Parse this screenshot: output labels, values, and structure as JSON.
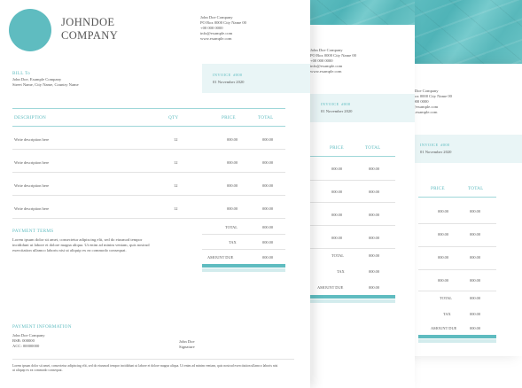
{
  "company": {
    "line1": "JOHNDOE",
    "line2": "COMPANY"
  },
  "contact": {
    "name": "John Doe Company",
    "address": "PO Box 0000 City Name 00",
    "phone": "+00 000 0000",
    "email": "info@example.com",
    "web": "www.example.com"
  },
  "bill_to": {
    "label": "BILL To",
    "name": "John Doe, Example Company",
    "street": "Street Name, City Name, Country Name"
  },
  "invoice": {
    "title": "INVOICE",
    "number": "#000",
    "date": "01 November 2020"
  },
  "table": {
    "headers": {
      "description": "DESCRIPTION",
      "qty": "QTY",
      "price": "PRICE",
      "total": "TOTAL"
    },
    "rows": [
      {
        "description": "Write description here",
        "qty": "12",
        "price": "000.00",
        "total": "000.00"
      },
      {
        "description": "Write description here",
        "qty": "12",
        "price": "000.00",
        "total": "000.00"
      },
      {
        "description": "Write description here",
        "qty": "12",
        "price": "000.00",
        "total": "000.00"
      },
      {
        "description": "Write description here",
        "qty": "12",
        "price": "000.00",
        "total": "000.00"
      }
    ]
  },
  "totals": {
    "total_label": "TOTAL",
    "total_value": "000.00",
    "tax_label": "TAX",
    "tax_value": "000.00",
    "due_label": "AMOUNT DUE",
    "due_value": "000.00"
  },
  "terms": {
    "label": "PAYMENT TERMS",
    "text": "Lorem ipsum dolor sit amet, consectetur adipiscing elit, sed do eiusmod tempor incididunt ut labore et dolore magna aliqua. Ut enim ad minim veniam, quis nostrud exercitation ullamco laboris nisi ut aliquip ex ea commodo consequat."
  },
  "payment_info": {
    "label": "PAYMENT INFORMATION",
    "company": "John Doe Company",
    "bsb": "BSB: 000000",
    "acc": "ACC: 00000000"
  },
  "signature": {
    "name": "John Doe",
    "label": "Signature"
  },
  "footer_text": "Lorem ipsum dolor sit amet, consectetur adipiscing elit, sed do eiusmod tempor incididunt ut labore et dolore magna aliqua. Ut enim ad minim veniam, quis nostrud exercitation ullamco laboris nisi ut aliquip ex ea commodo consequat.",
  "colors": {
    "accent": "#5fbcc0",
    "accent_light": "#e9f5f6"
  }
}
